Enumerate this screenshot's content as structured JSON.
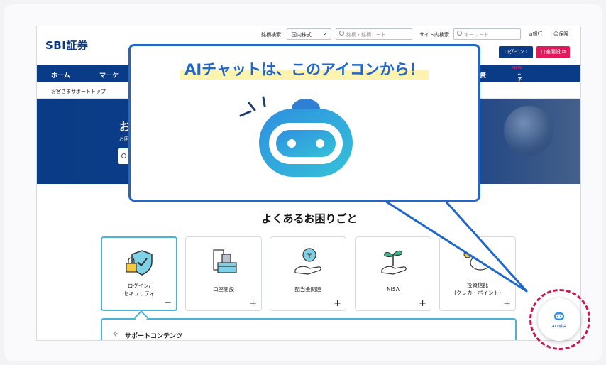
{
  "header": {
    "logo": "SBI証券",
    "stock_search_label": "銘柄検索",
    "stock_select": "国内株式",
    "stock_input_placeholder": "銘柄・銘柄コード",
    "site_search_label": "サイト内検索",
    "site_input_placeholder": "キーワード",
    "bank_link": "銀行",
    "insurance_link": "保険",
    "login_button": "ログイン",
    "open_account_button": "口座開設"
  },
  "global_nav": {
    "items": [
      "ホーム",
      "マーケ",
      "資",
      "その他の商品"
    ],
    "new_badge": "NEW"
  },
  "subnav": {
    "breadcrumb": "お客さまサポートトップ"
  },
  "hero": {
    "title": "お",
    "subtitle": "お困"
  },
  "faq": {
    "title": "よくあるお困りごと",
    "cards": [
      {
        "label": "ログイン/\nセキュリティ",
        "toggle": "−"
      },
      {
        "label": "口座開設",
        "toggle": "+"
      },
      {
        "label": "配当金関連",
        "toggle": "+"
      },
      {
        "label": "NISA",
        "toggle": "+"
      },
      {
        "label": "投資信託\n(クレカ・ポイント)",
        "toggle": "+"
      }
    ]
  },
  "support": {
    "title": "サポートコンテンツ"
  },
  "callout": {
    "title": "AIチャットは、このアイコンから！"
  },
  "ai_button": {
    "label": "AIで解決"
  },
  "colors": {
    "brand_navy": "#0a3b86",
    "brand_pink": "#e2195d",
    "callout_blue": "#1f67c9",
    "highlight_yellow": "#fff3b0",
    "ring_red": "#c8174f"
  }
}
